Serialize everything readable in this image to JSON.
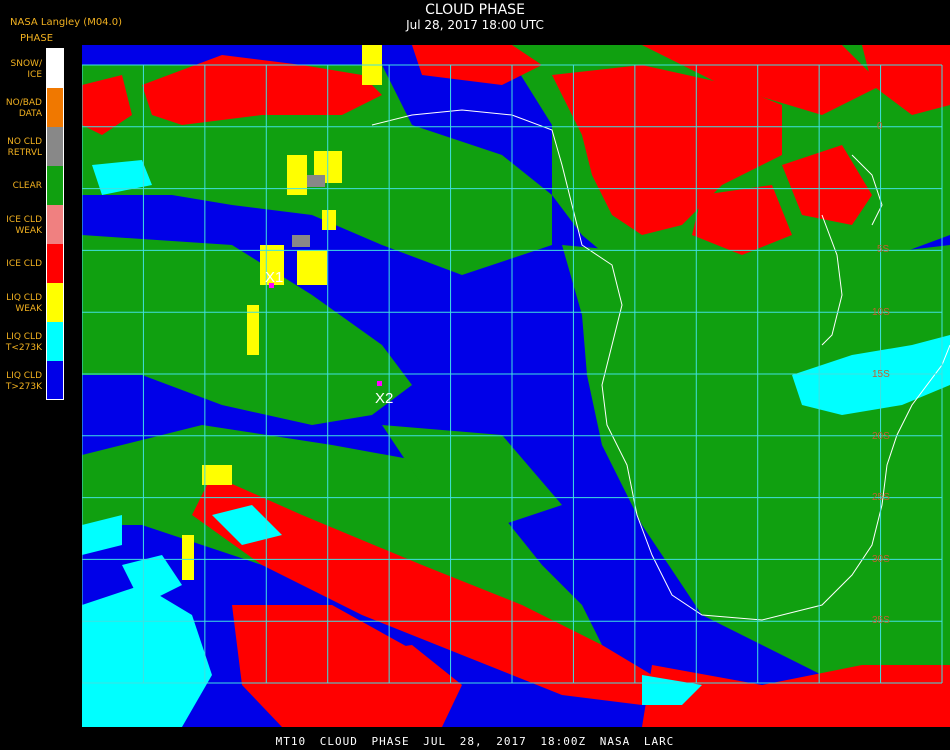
{
  "header": {
    "title": "CLOUD PHASE",
    "subtitle": "Jul 28, 2017 18:00 UTC",
    "source": "NASA Langley (M04.0)"
  },
  "legend": {
    "heading": "PHASE",
    "items": [
      {
        "label": "SNOW/\nICE",
        "color": "#ffffff"
      },
      {
        "label": "NO/BAD\nDATA",
        "color": "#f07800"
      },
      {
        "label": "NO CLD\nRETRVL",
        "color": "#888888"
      },
      {
        "label": "CLEAR",
        "color": "#10a010"
      },
      {
        "label": "ICE CLD\nWEAK",
        "color": "#f08080"
      },
      {
        "label": "ICE CLD",
        "color": "#ff0000"
      },
      {
        "label": "LIQ CLD\nWEAK",
        "color": "#ffff00"
      },
      {
        "label": "LIQ CLD\nT<273K",
        "color": "#00ffff"
      },
      {
        "label": "LIQ CLD\nT>273K",
        "color": "#0000e8"
      }
    ]
  },
  "markers": [
    {
      "label": "X1",
      "color": "#ff00ff"
    },
    {
      "label": "X2",
      "color": "#ff00ff"
    }
  ],
  "grid_labels": [
    "0",
    "5S",
    "10S",
    "15S",
    "20S",
    "25S",
    "30S",
    "35S"
  ],
  "colors": {
    "grid": "#40e0e0",
    "coast": "#ffffff",
    "grid_label": "#c06030"
  },
  "footer": "MT10  CLOUD PHASE   JUL 28, 2017 18:00Z   NASA LARC"
}
